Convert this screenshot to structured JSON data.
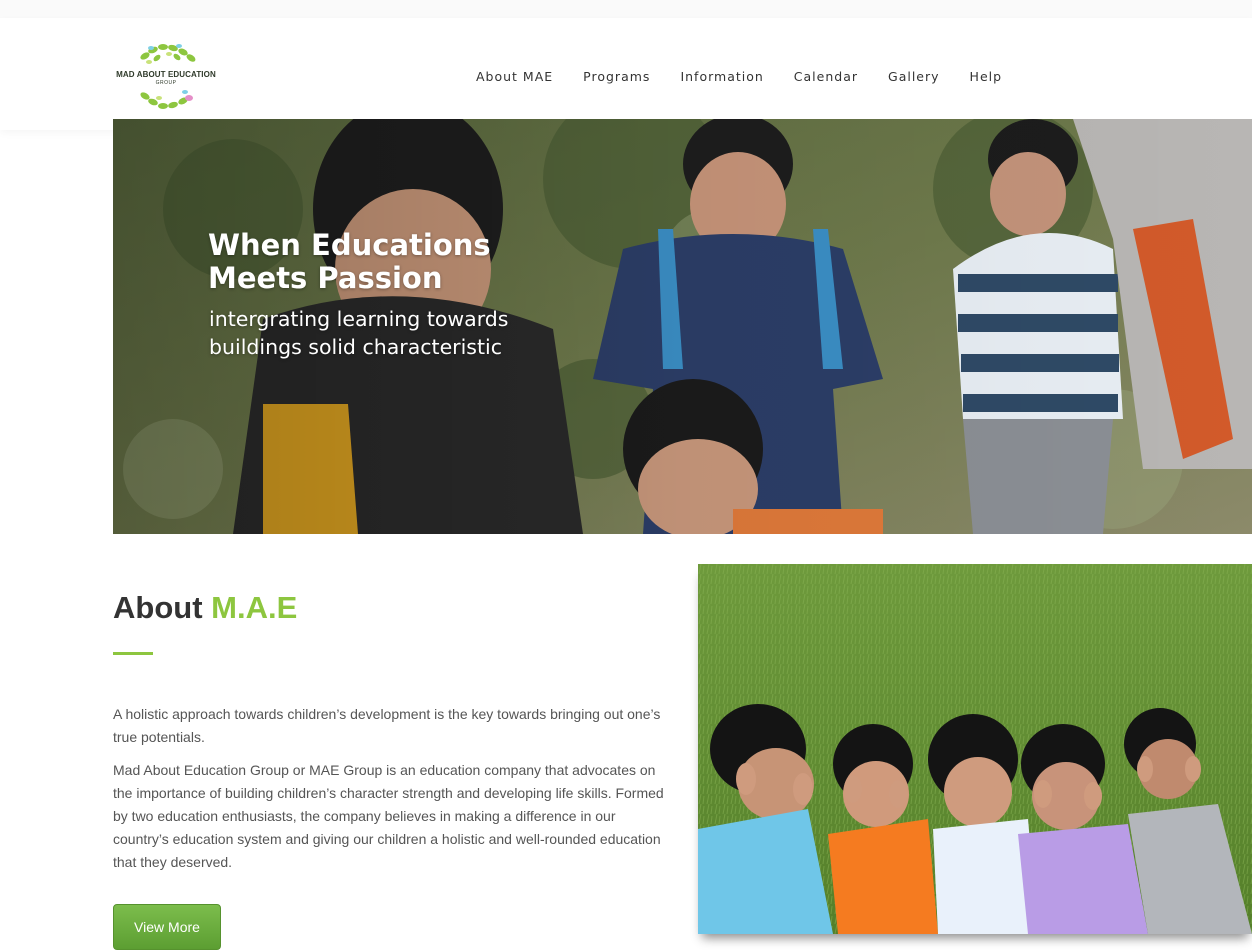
{
  "logo": {
    "name": "MAD ABOUT EDUCATION",
    "sub": "GROUP"
  },
  "nav": [
    "About MAE",
    "Programs",
    "Information",
    "Calendar",
    "Gallery",
    "Help"
  ],
  "hero": {
    "title": "When Educations Meets Passion",
    "subtitle": "intergrating learning towards buildings solid characteristic"
  },
  "about": {
    "title_prefix": "About",
    "title_accent": "M.A.E",
    "para1": "A holistic approach towards children’s development is the key towards bringing out one’s true potentials.",
    "para2": "Mad About Education Group or MAE Group is an education company that advocates on the importance of building children’s character strength and developing life skills. Formed by two education enthusiasts,  the company believes in making a difference in our country’s education system and giving our children a holistic and well-rounded education that they deserved.",
    "button": "View More"
  },
  "colors": {
    "accent": "#8dc63f",
    "button": "#6aaf3d"
  }
}
